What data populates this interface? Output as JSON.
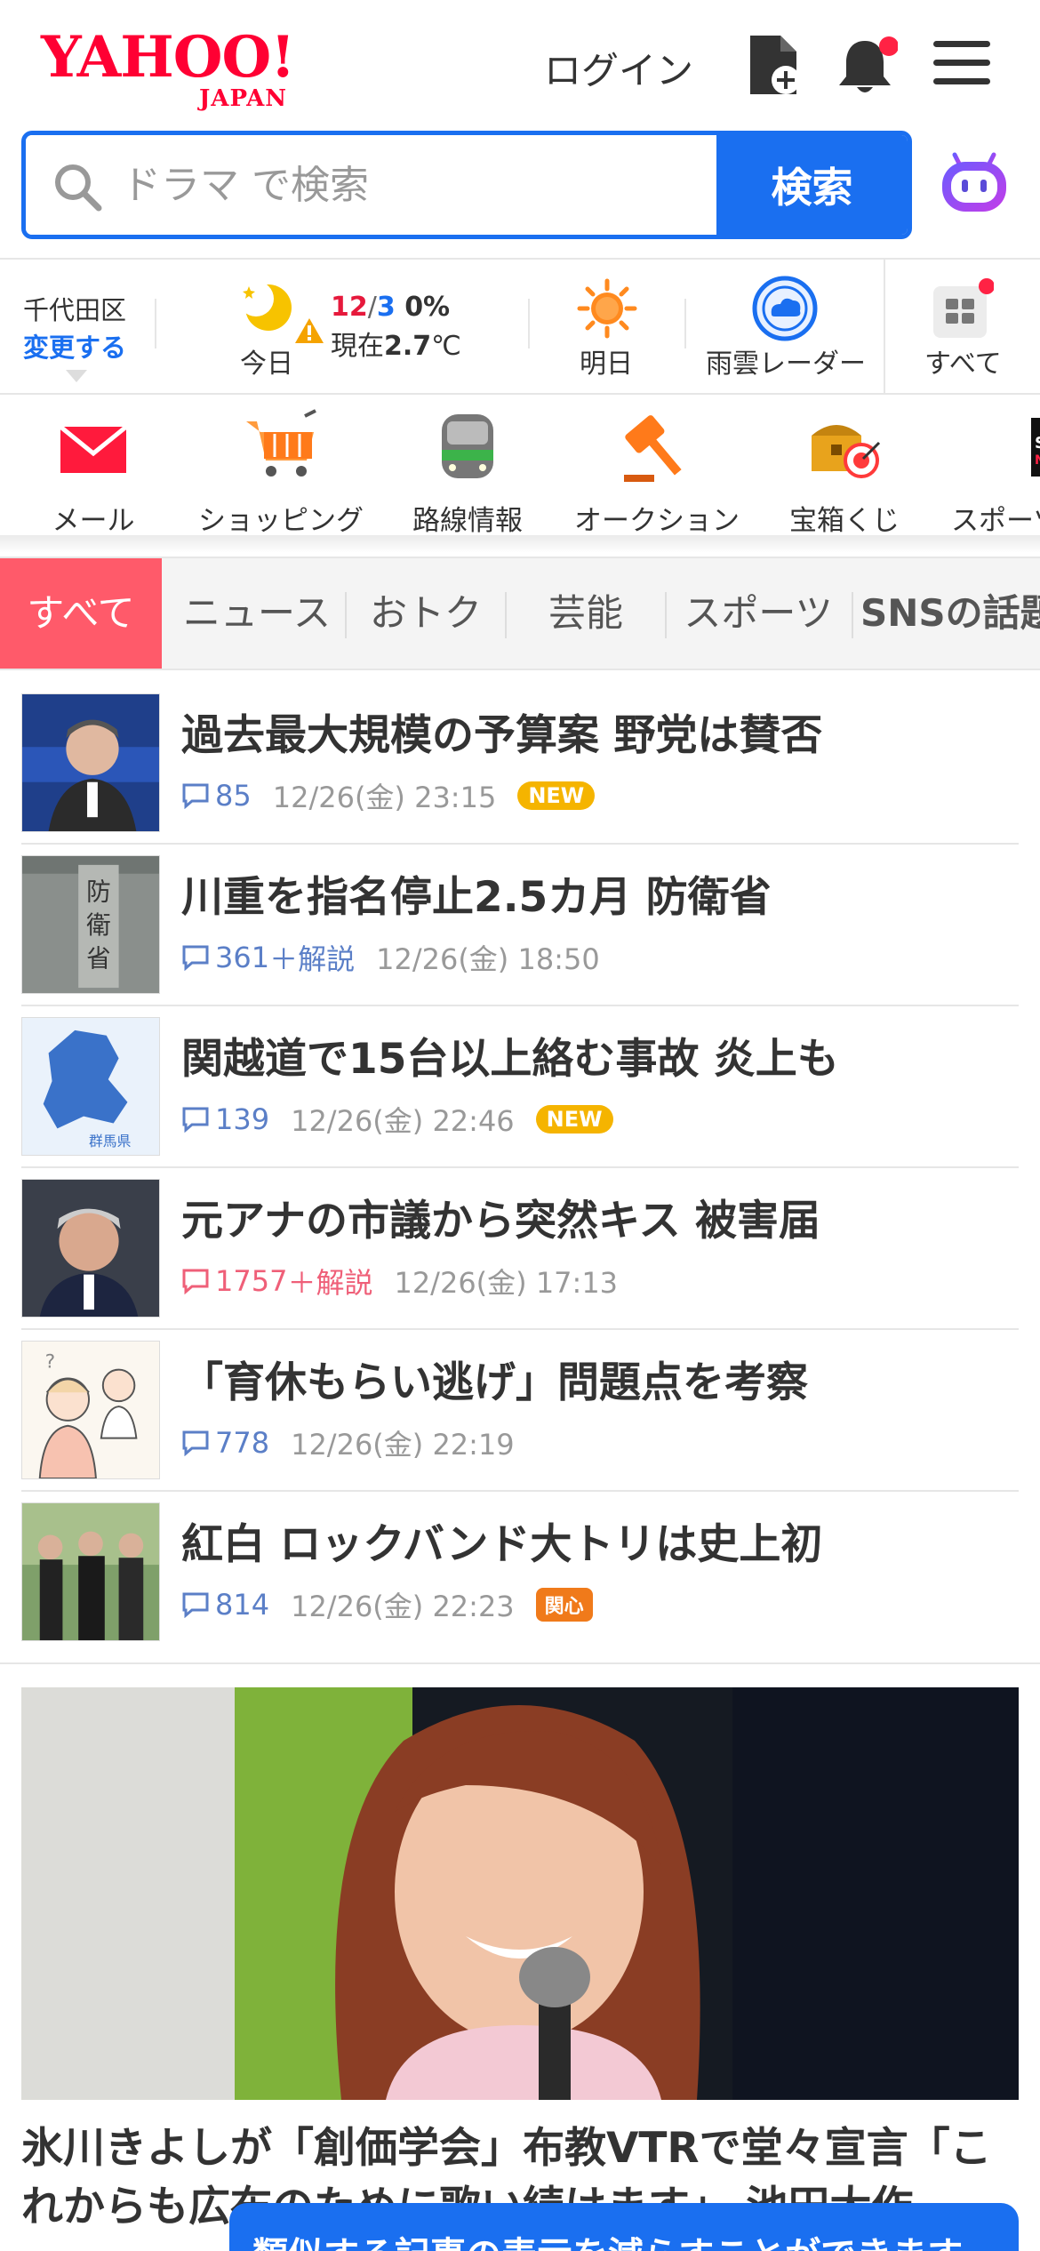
{
  "header": {
    "logo_main": "YAHOO!",
    "logo_sub": "JAPAN",
    "login_label": "ログイン"
  },
  "search": {
    "placeholder": "ドラマ で検索",
    "button_label": "検索"
  },
  "weather": {
    "area_name": "千代田区",
    "area_change": "変更する",
    "today_label": "今日",
    "high": "12",
    "low": "3",
    "rain": "0%",
    "now_prefix": "現在",
    "now_temp": "2.7",
    "now_unit": "℃",
    "tomorrow_label": "明日",
    "radar_label": "雨雲レーダー",
    "all_label": "すべて"
  },
  "services": [
    {
      "label": "メール",
      "icon": "mail-icon"
    },
    {
      "label": "ショッピング",
      "icon": "cart-icon"
    },
    {
      "label": "路線情報",
      "icon": "train-icon"
    },
    {
      "label": "オークション",
      "icon": "gavel-icon"
    },
    {
      "label": "宝箱くじ",
      "icon": "treasure-icon"
    },
    {
      "label": "スポーツ",
      "icon": "sports-icon"
    }
  ],
  "tabs": [
    "すべて",
    "ニュース",
    "おトク",
    "芸能",
    "スポーツ",
    "SNSの話題"
  ],
  "news": [
    {
      "title": "過去最大規模の予算案 野党は賛否",
      "comments": "85",
      "kaisetsu": "",
      "date": "12/26(金) 23:15",
      "badge": "NEW"
    },
    {
      "title": "川重を指名停止2.5カ月 防衛省",
      "comments": "361",
      "kaisetsu": "＋解説",
      "date": "12/26(金) 18:50",
      "badge": ""
    },
    {
      "title": "関越道で15台以上絡む事故 炎上も",
      "comments": "139",
      "kaisetsu": "",
      "date": "12/26(金) 22:46",
      "badge": "NEW"
    },
    {
      "title": "元アナの市議から突然キス 被害届",
      "comments": "1757",
      "kaisetsu": "＋解説",
      "date": "12/26(金) 17:13",
      "badge": ""
    },
    {
      "title": "「育休もらい逃げ」問題点を考察",
      "comments": "778",
      "kaisetsu": "",
      "date": "12/26(金) 22:19",
      "badge": ""
    },
    {
      "title": "紅白 ロックバンド大トリは史上初",
      "comments": "814",
      "kaisetsu": "",
      "date": "12/26(金) 22:23",
      "badge": "関心"
    }
  ],
  "thumb_text": {
    "gunma": "群馬県",
    "bouei": "防衛省"
  },
  "feature": {
    "headline": "氷川きよしが「創価学会」布教VTRで堂々宣言「これからも広布のために歌い続けます」 池田大作"
  },
  "toast": {
    "text": "類似する記事の表示を減らすことができます"
  },
  "colors": {
    "brand_red": "#ff0033",
    "accent_blue": "#1a6ff0",
    "tab_active": "#ff5a6a",
    "new_badge": "#f5b400"
  }
}
